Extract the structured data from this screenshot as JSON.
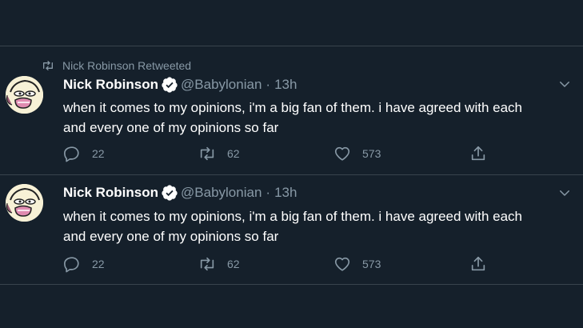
{
  "tweets": [
    {
      "retweet_label": "Nick Robinson Retweeted",
      "name": "Nick Robinson",
      "handle": "@Babylonian",
      "dot": "·",
      "time": "13h",
      "text_line1": "when it comes to my opinions, i'm a big fan of them. i have agreed with each",
      "text_line2": "and every one of my opinions so far",
      "replies": "22",
      "retweets": "62",
      "likes": "573"
    },
    {
      "name": "Nick Robinson",
      "handle": "@Babylonian",
      "dot": "·",
      "time": "13h",
      "text_line1": "when it comes to my opinions, i'm a big fan of them. i have agreed with each",
      "text_line2": "and every one of my opinions so far",
      "replies": "22",
      "retweets": "62",
      "likes": "573"
    }
  ],
  "colors": {
    "background": "#15202b",
    "divider": "#38444d",
    "secondary_text": "#8899a6",
    "primary_text": "#ffffff",
    "verified_badge": "#ffffff"
  },
  "icons": [
    "retweet-icon",
    "verified-icon",
    "chevron-down-icon",
    "reply-icon",
    "like-icon",
    "share-icon"
  ]
}
